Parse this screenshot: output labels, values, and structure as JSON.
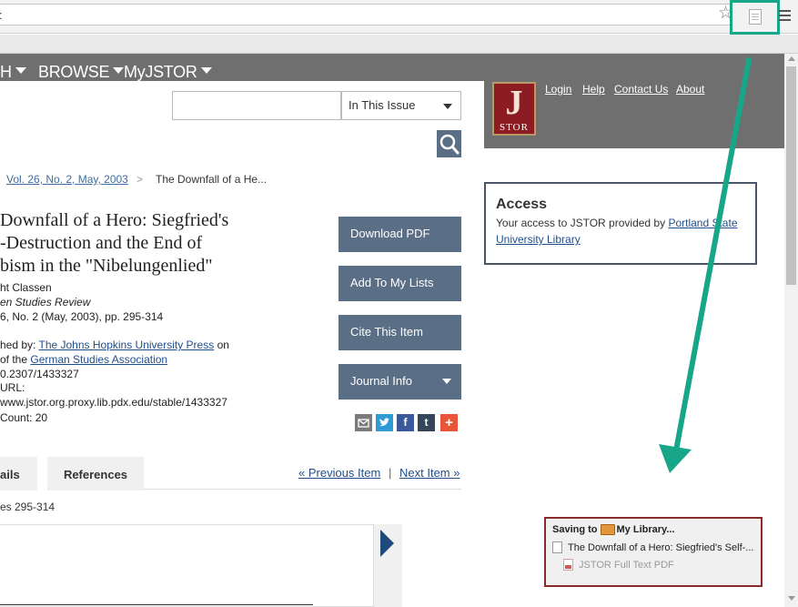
{
  "browser": {
    "url_text": ":",
    "star_icon": "star-outline-icon",
    "zotero_icon": "document-icon",
    "menu_icon": "hamburger-menu-icon"
  },
  "nav": {
    "items": [
      {
        "label": "H"
      },
      {
        "label": "BROWSE"
      },
      {
        "label": "MyJSTOR"
      }
    ],
    "links": [
      "Login",
      "Help",
      "Contact Us",
      "About"
    ],
    "logo_letter": "J",
    "logo_text": "STOR"
  },
  "search": {
    "placeholder": "",
    "scope": "In This Issue",
    "search_icon": "magnifier-icon"
  },
  "breadcrumb": {
    "issue": "Vol. 26, No. 2, May, 2003",
    "separator": ">",
    "current": "The Downfall of a He..."
  },
  "article": {
    "title_lines": [
      "Downfall of a Hero: Siegfried's",
      "-Destruction and the End of",
      "bism in the \"Nibelungenlied\""
    ],
    "author": "ht Classen",
    "journal": "en Studies Review",
    "volume": "6, No. 2 (May, 2003), pp. 295-314",
    "published_prefix": "hed by: ",
    "publisher": "The Johns Hopkins University Press",
    "published_suffix": " on",
    "of_prefix": "of the ",
    "association": "German Studies Association",
    "doi": "0.2307/1433327",
    "url_label": " URL:",
    "stable_url": "www.jstor.org.proxy.lib.pdx.edu/stable/1433327",
    "count": "Count: 20"
  },
  "actions": {
    "download": "Download PDF",
    "add_list": "Add To My Lists",
    "cite": "Cite This Item",
    "journal_info": "Journal Info"
  },
  "share": {
    "email_icon": "email-icon",
    "twitter_icon": "twitter-icon",
    "facebook": "f",
    "tumblr": "t",
    "more": "+",
    "colors": {
      "email": "#7b7b7b",
      "twitter": "#2f9bd6",
      "facebook": "#3b5998",
      "tumblr": "#35465c",
      "more": "#e9553a"
    }
  },
  "tabs": {
    "details": "ails",
    "references": "References",
    "prev": "« Previous Item",
    "pipe": "|",
    "next": "Next Item »",
    "pages": "es 295-314"
  },
  "access": {
    "title": "Access",
    "text_prefix": "Your access to JSTOR provided by ",
    "library_line1": "Portland State",
    "library_line2": "University Library"
  },
  "zotero_popup": {
    "saving_label": "Saving to",
    "library": "My Library...",
    "item": "The Downfall of a Hero: Siegfried's Self-...",
    "attachment": "JSTOR Full Text PDF",
    "folder_icon": "folder-icon"
  },
  "colors": {
    "accent_arrow": "#17a688",
    "nav_bg": "#6f6f6f",
    "button_bg": "#5a6e85",
    "logo_bg": "#8c1b22",
    "popup_border": "#8b2a2a"
  }
}
